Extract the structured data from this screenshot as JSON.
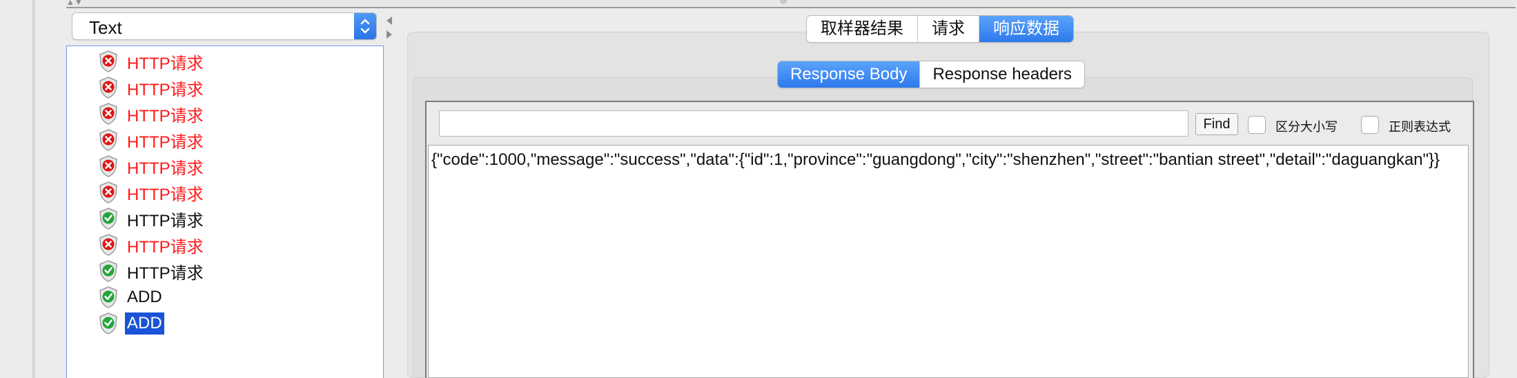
{
  "render_select": {
    "value": "Text"
  },
  "tree": {
    "items": [
      {
        "label": "HTTP请求",
        "status": "fail"
      },
      {
        "label": "HTTP请求",
        "status": "fail"
      },
      {
        "label": "HTTP请求",
        "status": "fail"
      },
      {
        "label": "HTTP请求",
        "status": "fail"
      },
      {
        "label": "HTTP请求",
        "status": "fail"
      },
      {
        "label": "HTTP请求",
        "status": "fail"
      },
      {
        "label": "HTTP请求",
        "status": "ok"
      },
      {
        "label": "HTTP请求",
        "status": "fail"
      },
      {
        "label": "HTTP请求",
        "status": "ok"
      },
      {
        "label": "ADD",
        "status": "ok"
      },
      {
        "label": "ADD",
        "status": "ok",
        "selected": true
      }
    ]
  },
  "tabs": [
    {
      "label": "取样器结果"
    },
    {
      "label": "请求"
    },
    {
      "label": "响应数据",
      "active": true
    }
  ],
  "subtabs": [
    {
      "label": "Response Body",
      "active": true
    },
    {
      "label": "Response headers"
    }
  ],
  "search": {
    "value": "",
    "find_label": "Find"
  },
  "options": {
    "case_sensitive_label": "区分大小写",
    "regex_label": "正则表达式"
  },
  "response_body": "{\"code\":1000,\"message\":\"success\",\"data\":{\"id\":1,\"province\":\"guangdong\",\"city\":\"shenzhen\",\"street\":\"bantian street\",\"detail\":\"daguangkan\"}}",
  "colors": {
    "fail_text": "#ff1a1a",
    "selection": "#1a53d6",
    "accent_blue": "#2e79ec"
  }
}
